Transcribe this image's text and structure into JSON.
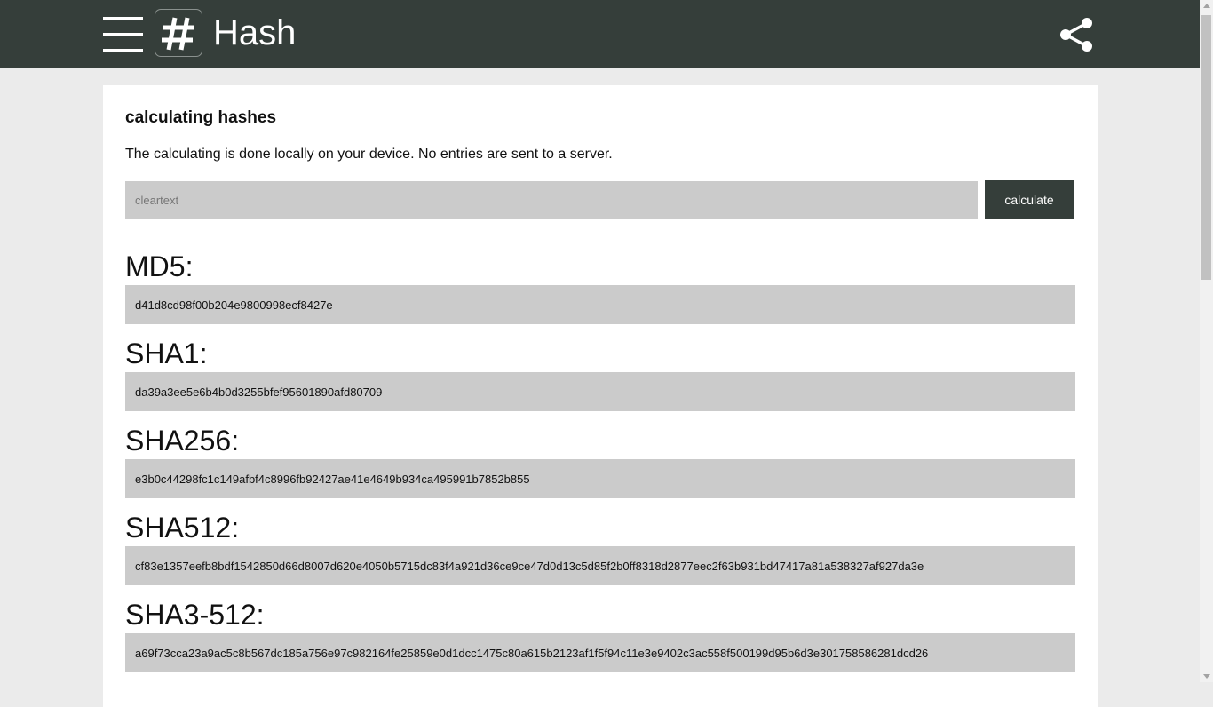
{
  "header": {
    "app_title": "Hash",
    "logo_glyph": "#",
    "background_color": "#353e3a"
  },
  "card": {
    "title": "calculating hashes",
    "description": "The calculating is done locally on your device. No entries are sent to a server.",
    "input_placeholder": "cleartext",
    "input_value": "",
    "calculate_label": "calculate"
  },
  "hashes": [
    {
      "label": "MD5:",
      "value": "d41d8cd98f00b204e9800998ecf8427e"
    },
    {
      "label": "SHA1:",
      "value": "da39a3ee5e6b4b0d3255bfef95601890afd80709"
    },
    {
      "label": "SHA256:",
      "value": "e3b0c44298fc1c149afbf4c8996fb92427ae41e4649b934ca495991b7852b855"
    },
    {
      "label": "SHA512:",
      "value": "cf83e1357eefb8bdf1542850d66d8007d620e4050b5715dc83f4a921d36ce9ce47d0d13c5d85f2b0ff8318d2877eec2f63b931bd47417a81a538327af927da3e"
    },
    {
      "label": "SHA3-512:",
      "value": "a69f73cca23a9ac5c8b567dc185a756e97c982164fe25859e0d1dcc1475c80a615b2123af1f5f94c11e3e9402c3ac558f500199d95b6d3e301758586281dcd26"
    }
  ],
  "icons": {
    "menu": "hamburger-menu-icon",
    "logo": "hash-logo-icon",
    "share": "share-icon"
  }
}
